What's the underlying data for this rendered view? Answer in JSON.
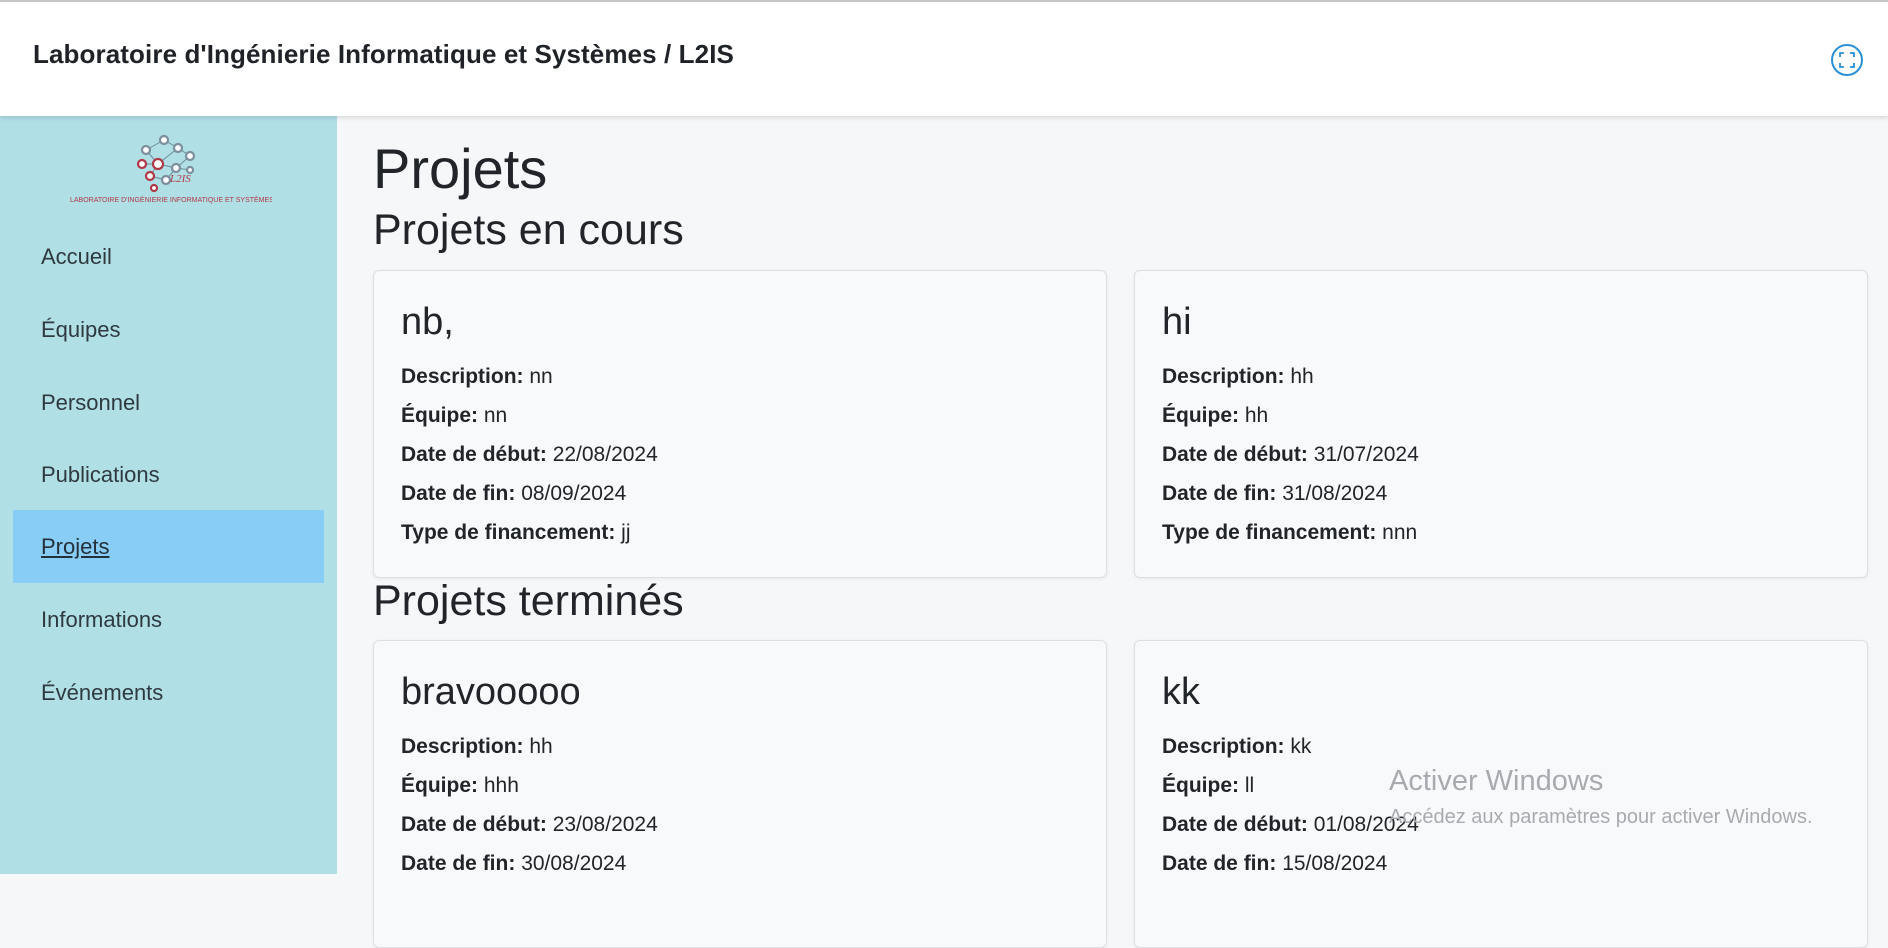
{
  "header": {
    "title": "Laboratoire d'Ingénierie Informatique et Systèmes / L2IS",
    "fullscreen_icon": "fullscreen-icon"
  },
  "sidebar": {
    "logo_text": "LABORATOIRE D'INGÉNIERIE INFORMATIQUE ET SYSTÈMES",
    "logo_short": "L2IS",
    "items": [
      {
        "label": "Accueil",
        "active": false
      },
      {
        "label": "Équipes",
        "active": false
      },
      {
        "label": "Personnel",
        "active": false
      },
      {
        "label": "Publications",
        "active": false
      },
      {
        "label": "Projets",
        "active": true
      },
      {
        "label": "Informations",
        "active": false
      },
      {
        "label": "Événements",
        "active": false
      }
    ]
  },
  "labels": {
    "description": "Description:",
    "equipe": "Équipe:",
    "date_debut": "Date de début:",
    "date_fin": "Date de fin:",
    "financement": "Type de financement:"
  },
  "main": {
    "title": "Projets",
    "current_title": "Projets en cours",
    "finished_title": "Projets terminés",
    "current": [
      {
        "name": "nb,",
        "description": "nn",
        "equipe": "nn",
        "date_debut": "22/08/2024",
        "date_fin": "08/09/2024",
        "financement": "jj"
      },
      {
        "name": "hi",
        "description": "hh",
        "equipe": "hh",
        "date_debut": "31/07/2024",
        "date_fin": "31/08/2024",
        "financement": "nnn"
      }
    ],
    "finished": [
      {
        "name": "bravooooo",
        "description": "hh",
        "equipe": "hhh",
        "date_debut": "23/08/2024",
        "date_fin": "30/08/2024"
      },
      {
        "name": "kk",
        "description": "kk",
        "equipe": "ll",
        "date_debut": "01/08/2024",
        "date_fin": "15/08/2024"
      }
    ]
  },
  "watermark": {
    "line1": "Activer Windows",
    "line2": "Accédez aux paramètres pour activer Windows."
  },
  "colors": {
    "sidebar_bg": "#b0dfe5",
    "active_item": "#88cdf6",
    "accent": "#2b8fd6"
  }
}
